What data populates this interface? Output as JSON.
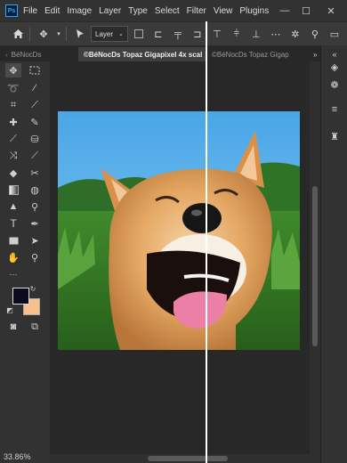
{
  "menu": {
    "app_icon": "Ps",
    "items": [
      "File",
      "Edit",
      "Image",
      "Layer",
      "Type",
      "Select",
      "Filter",
      "View",
      "Plugins"
    ]
  },
  "window_controls": {
    "minimize": "—",
    "maximize": "☐",
    "close": "✕"
  },
  "options_bar": {
    "layer_select": "Layer"
  },
  "tabs": [
    {
      "label": "BéNocDs"
    },
    {
      "label": "©BéNocDs Topaz Gigapixel 4x scal"
    },
    {
      "label": "©BéNocDs Topaz Gigap"
    }
  ],
  "colors": {
    "foreground": "#0b0b1e",
    "background": "#f7c08d",
    "photoshop_blue": "#31a8ff"
  },
  "status": {
    "zoom": "33.86%"
  }
}
